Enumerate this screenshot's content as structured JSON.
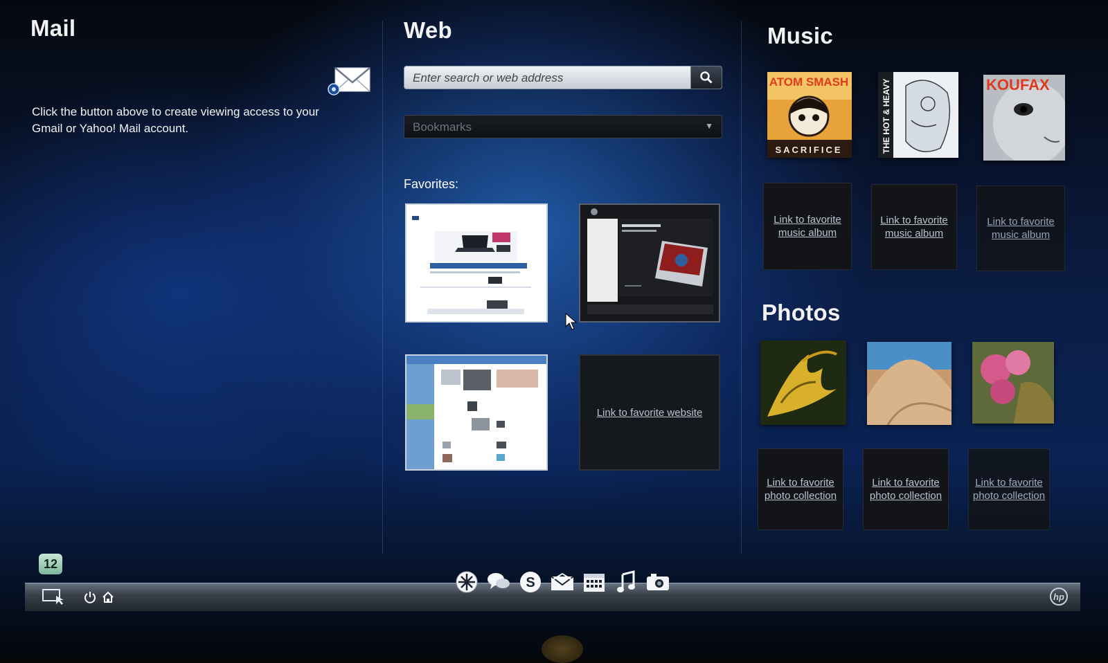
{
  "mail": {
    "title": "Mail",
    "hint": "Click the button above to create viewing access to your Gmail or Yahoo! Mail account.",
    "button_icon": "mail-envelope-icon"
  },
  "web": {
    "title": "Web",
    "search_placeholder": "Enter search or web address",
    "bookmarks_label": "Bookmarks",
    "favorites_label": "Favorites:",
    "empty_favorite_link": "Link to favorite website"
  },
  "music": {
    "title": "Music",
    "albums": [
      {
        "text": "ATOM SMASH",
        "subtext": "SACRIFICE"
      },
      {
        "text": "THE HOT & HEAVY"
      },
      {
        "text": "KOUFAX"
      }
    ],
    "empty_links": [
      "Link to favorite music album",
      "Link to favorite music album",
      "Link to favorite music album"
    ]
  },
  "photos": {
    "title": "Photos",
    "empty_links": [
      "Link to favorite photo collection",
      "Link to favorite photo collection",
      "Link to favorite photo collection"
    ]
  },
  "taskbar": {
    "notification_count": "12",
    "dock_icons": [
      "touchsmart-icon",
      "chat-icon",
      "skype-icon",
      "mail-icon",
      "calendar-icon",
      "music-icon",
      "camera-icon"
    ]
  },
  "colors": {
    "accent_blue": "#1e5fb8",
    "link": "#b9c3d0",
    "album_red": "#e03a1e"
  }
}
